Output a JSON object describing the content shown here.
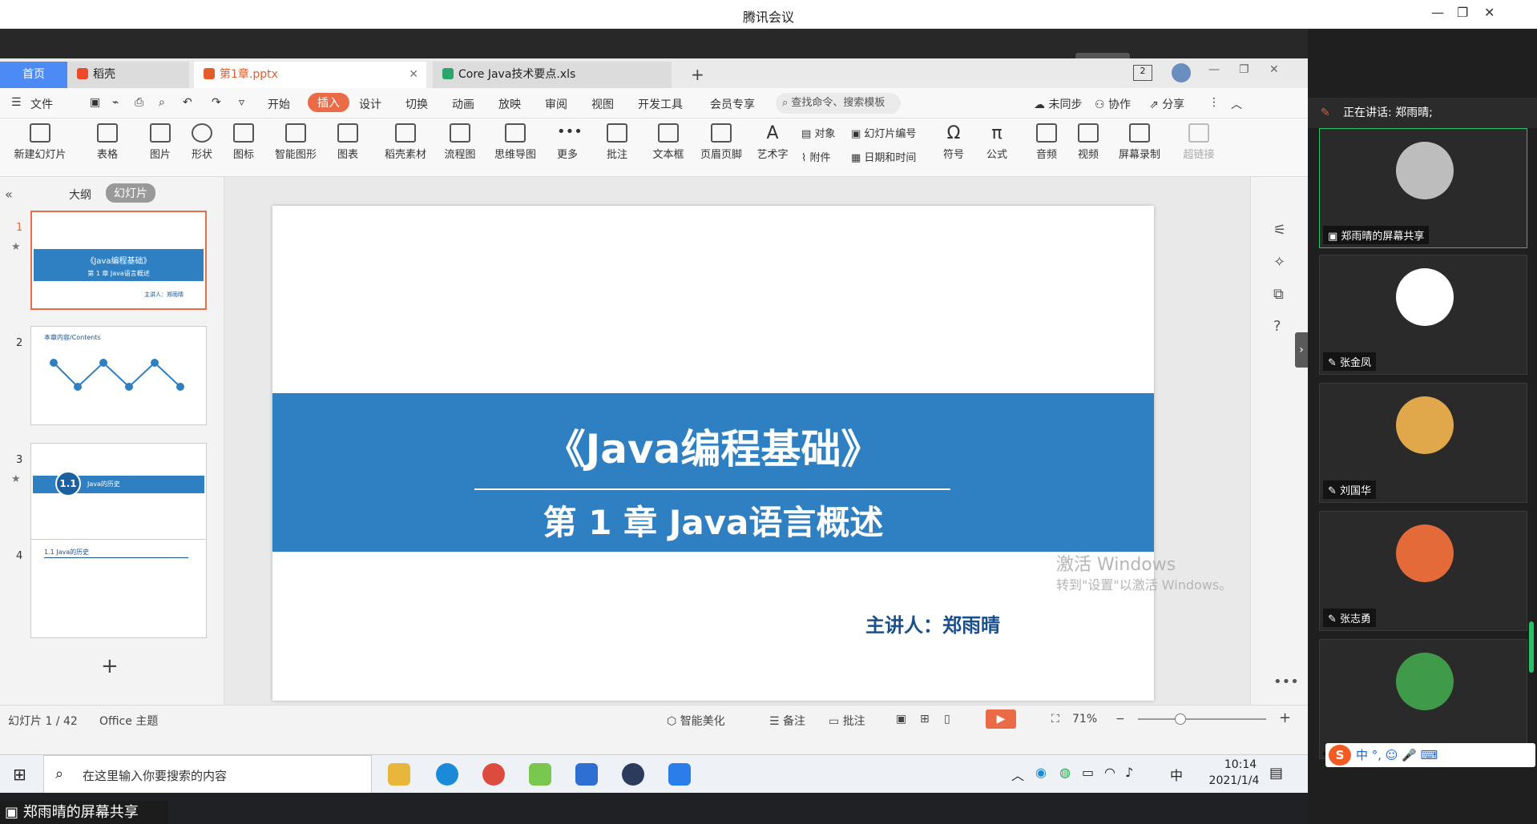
{
  "window": {
    "title": "腾讯会议"
  },
  "tabs": {
    "home": "首页",
    "docer": "稻壳",
    "doc1": "第1章.pptx",
    "doc2": "Core Java技术要点.xls",
    "new_tab": "+"
  },
  "menu": {
    "file": "文件",
    "items": [
      "开始",
      "插入",
      "设计",
      "切换",
      "动画",
      "放映",
      "审阅",
      "视图",
      "开发工具",
      "会员专享"
    ],
    "active": "插入",
    "search_placeholder": "查找命令、搜索模板",
    "sync": "未同步",
    "collab": "协作",
    "share": "分享"
  },
  "ribbon": {
    "items": [
      "新建幻灯片",
      "表格",
      "图片",
      "形状",
      "图标",
      "智能图形",
      "图表",
      "稻壳素材",
      "流程图",
      "思维导图",
      "更多",
      "批注",
      "文本框",
      "页眉页脚",
      "艺术字",
      "符号",
      "公式",
      "音频",
      "视频",
      "屏幕录制",
      "超链接"
    ],
    "small": {
      "object": "对象",
      "slide_number": "幻灯片编号",
      "attachment": "附件",
      "datetime": "日期和时间"
    }
  },
  "leftpane": {
    "outline_tab": "大纲",
    "slides_tab": "幻灯片",
    "thumb_numbers": [
      "1",
      "2",
      "3",
      "4"
    ],
    "thumb1_title": "《Java编程基础》",
    "thumb1_sub": "第 1 章 Java语言概述",
    "thumb1_author": "主讲人：郑雨晴",
    "thumb2_title": "本章内容/Contents",
    "thumb3_num": "1.1",
    "thumb3_text": "Java的历史",
    "thumb4_title": "1.1 Java的历史",
    "add": "+"
  },
  "slide": {
    "title": "《Java编程基础》",
    "subtitle": "第 1 章  Java语言概述",
    "author": "主讲人：郑雨晴"
  },
  "watermark": {
    "line1": "激活 Windows",
    "line2": "转到\"设置\"以激活 Windows。"
  },
  "status": {
    "slide_counter": "幻灯片 1 / 42",
    "theme": "Office 主题",
    "beautify": "智能美化",
    "notes": "备注",
    "comments": "批注",
    "zoom": "71%",
    "minus": "−",
    "plus": "+"
  },
  "taskbar": {
    "search_placeholder": "在这里输入你要搜索的内容",
    "ime": "中",
    "time": "10:14",
    "date": "2021/1/4"
  },
  "share_label": "郑雨晴的屏幕共享",
  "meeting": {
    "speaking": "正在讲话: 郑雨晴;",
    "participants": [
      {
        "name": "郑雨晴的屏幕共享"
      },
      {
        "name": "张金凤"
      },
      {
        "name": "刘国华"
      },
      {
        "name": "张志勇"
      },
      {
        "name": ""
      }
    ],
    "ime_bar": "中 °, ☺ 🎤 ⌨"
  },
  "colors": {
    "accent": "#ec6b47",
    "slide_band": "#2f7fc3",
    "home_tab": "#4c8bf5",
    "panel_bg": "#1f1f1f"
  }
}
